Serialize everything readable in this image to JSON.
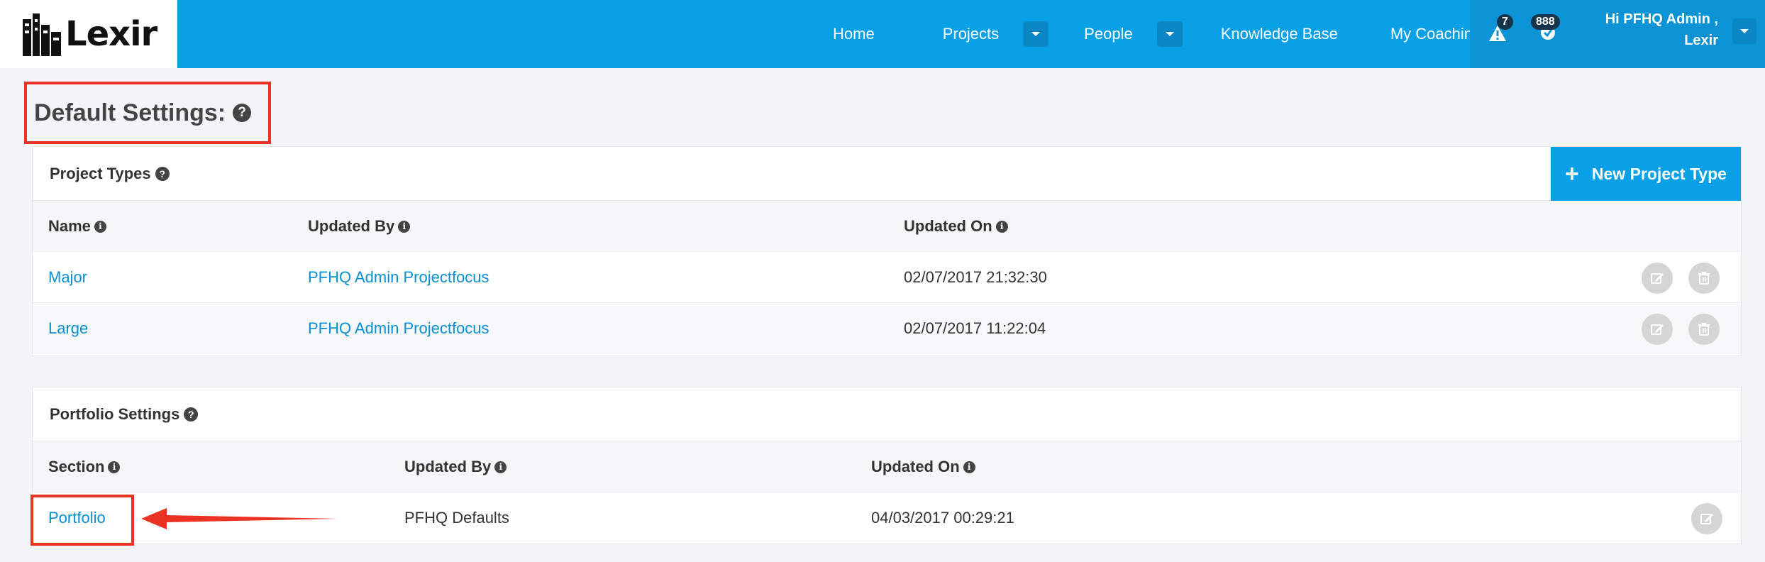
{
  "app": {
    "logo_text": "Lexir"
  },
  "nav": {
    "links": [
      "Home",
      "Projects",
      "People",
      "Knowledge Base",
      "My Coaching"
    ],
    "alert_count": "7",
    "notification_count": "888",
    "user_line1": "Hi PFHQ Admin ,",
    "user_line2": "Lexir"
  },
  "page": {
    "title": "Default Settings:"
  },
  "project_types": {
    "title": "Project Types",
    "new_button": "New Project Type",
    "columns": [
      "Name",
      "Updated By",
      "Updated On"
    ],
    "rows": [
      {
        "name": "Major",
        "updated_by": "PFHQ Admin Projectfocus",
        "updated_on": "02/07/2017 21:32:30"
      },
      {
        "name": "Large",
        "updated_by": "PFHQ Admin Projectfocus",
        "updated_on": "02/07/2017 11:22:04"
      }
    ]
  },
  "portfolio_settings": {
    "title": "Portfolio Settings",
    "columns": [
      "Section",
      "Updated By",
      "Updated On"
    ],
    "rows": [
      {
        "section": "Portfolio",
        "updated_by": "PFHQ Defaults",
        "updated_on": "04/03/2017 00:29:21"
      }
    ]
  },
  "colors": {
    "brand": "#0aa0e6",
    "highlight": "#ea3323",
    "link": "#0a8ed2"
  },
  "icons": [
    "building-logo-icon",
    "caret-down-icon",
    "alert-icon",
    "notification-icon",
    "help-icon",
    "info-icon",
    "plus-icon",
    "edit-icon",
    "trash-icon",
    "arrow-icon"
  ]
}
